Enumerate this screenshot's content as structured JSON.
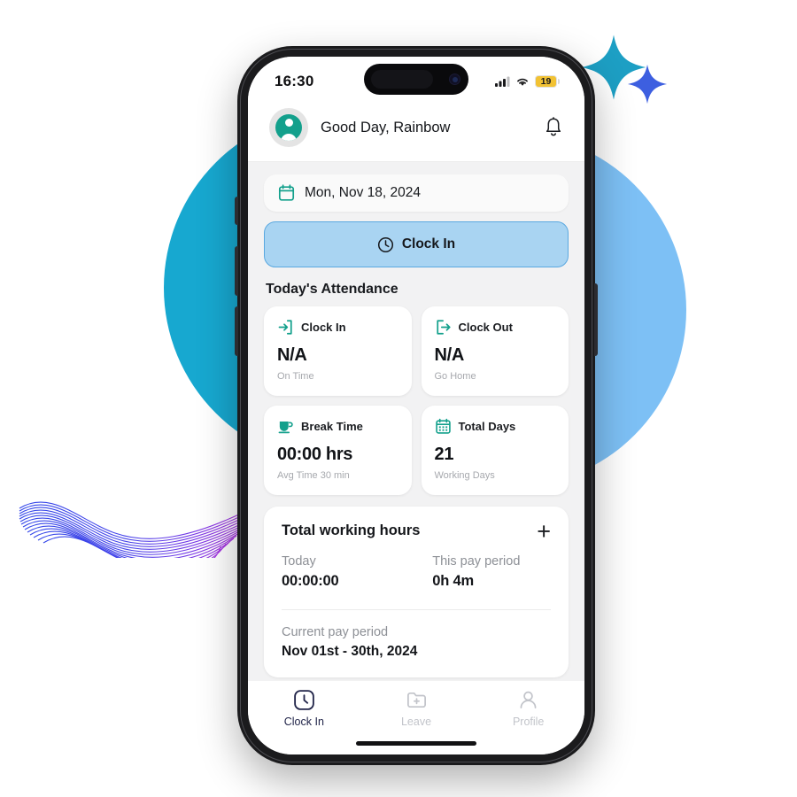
{
  "background": {
    "circle_left_color": "#17a8d0",
    "circle_right_color": "#7dc0f5",
    "sparkle_large_color": "#1d9fc4",
    "sparkle_small_color": "#3d5fe0",
    "wave_color_start": "#2244ee",
    "wave_color_end": "#9b2ae0"
  },
  "statusbar": {
    "time": "16:30",
    "battery_level": "19",
    "battery_color": "#f2c233",
    "signal_icon": "cellular-signal-icon",
    "wifi_icon": "wifi-icon"
  },
  "header": {
    "avatar_icon": "user-avatar-icon",
    "greeting": "Good Day, Rainbow",
    "notification_icon": "bell-icon"
  },
  "date_pill": {
    "icon": "calendar-icon",
    "text": "Mon, Nov 18, 2024",
    "icon_color": "#13a08c"
  },
  "clock_in_button": {
    "icon": "clock-icon",
    "label": "Clock In",
    "bg_color": "#a9d4f2",
    "border_color": "#5aa8e0"
  },
  "attendance": {
    "section_title": "Today's Attendance",
    "cards": [
      {
        "icon": "login-arrow-icon",
        "label": "Clock In",
        "value": "N/A",
        "sub": "On Time"
      },
      {
        "icon": "logout-arrow-icon",
        "label": "Clock Out",
        "value": "N/A",
        "sub": "Go Home"
      },
      {
        "icon": "coffee-cup-icon",
        "label": "Break Time",
        "value": "00:00 hrs",
        "sub": "Avg Time 30 min"
      },
      {
        "icon": "calendar-grid-icon",
        "label": "Total Days",
        "value": "21",
        "sub": "Working Days"
      }
    ]
  },
  "working_hours": {
    "title": "Total working hours",
    "add_icon": "plus-icon",
    "today_label": "Today",
    "today_value": "00:00:00",
    "pay_period_label": "This pay period",
    "pay_period_value": "0h 4m",
    "current_period_label": "Current pay period",
    "current_period_value": "Nov 01st - 30th, 2024"
  },
  "tabbar": {
    "active_color": "#212449",
    "inactive_color": "#c2c4ca",
    "tabs": [
      {
        "icon": "clock-square-icon",
        "label": "Clock In",
        "active": true
      },
      {
        "icon": "folder-plus-icon",
        "label": "Leave",
        "active": false
      },
      {
        "icon": "person-icon",
        "label": "Profile",
        "active": false
      }
    ]
  }
}
